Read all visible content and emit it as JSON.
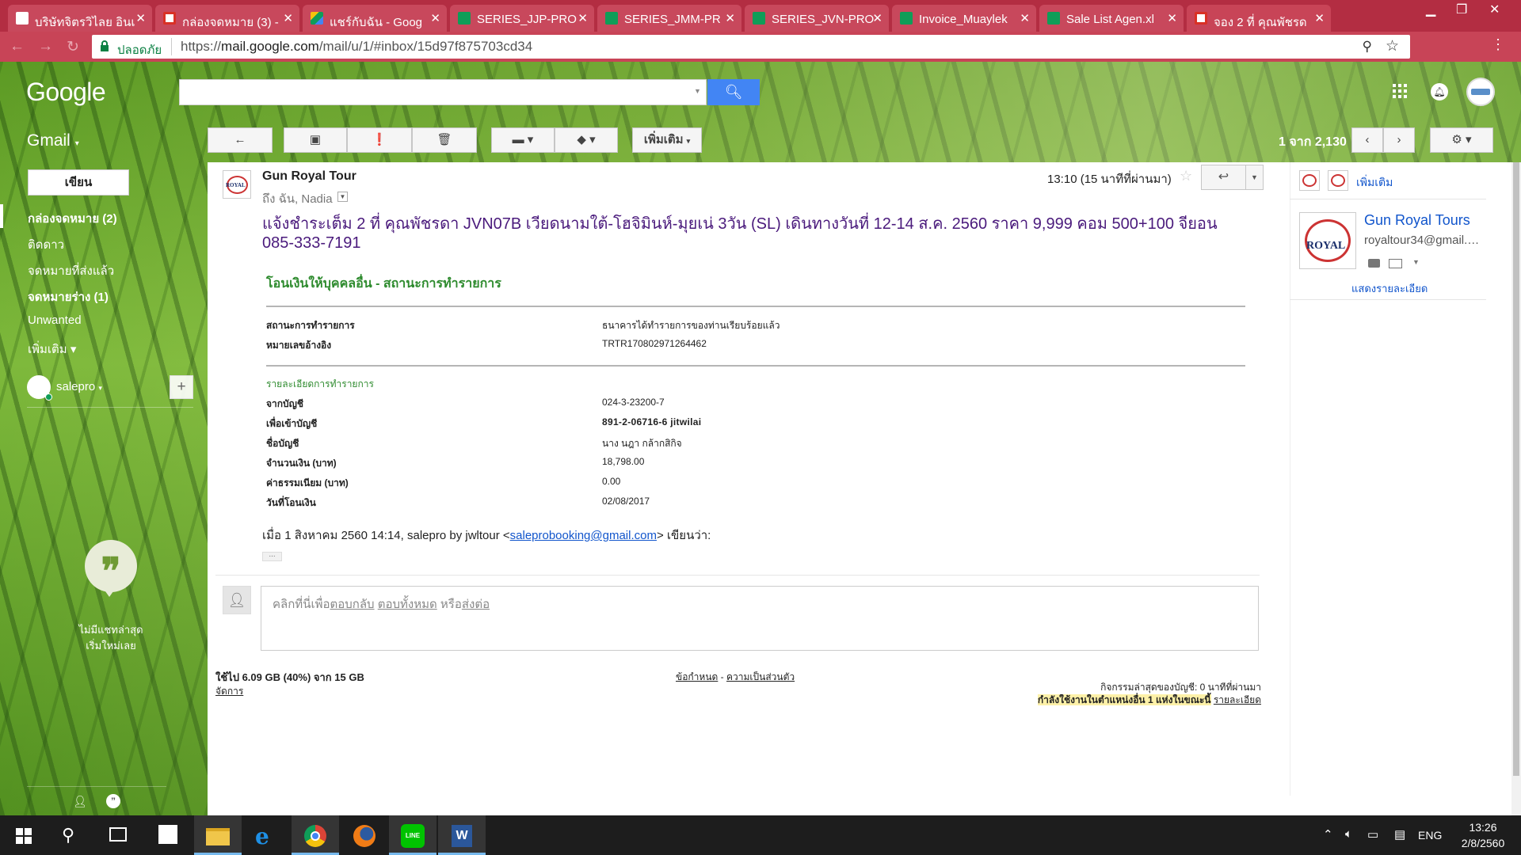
{
  "browser": {
    "tabs": [
      {
        "label": "บริษัทจิตรวิไลย อินเ",
        "active": false
      },
      {
        "label": "กล่องจดหมาย (3) -",
        "active": false
      },
      {
        "label": "แชร์กับฉัน - Goog",
        "active": false
      },
      {
        "label": "SERIES_JJP-PRO",
        "active": false
      },
      {
        "label": "SERIES_JMM-PR",
        "active": false
      },
      {
        "label": "SERIES_JVN-PRO",
        "active": false
      },
      {
        "label": "Invoice_Muaylek",
        "active": false
      },
      {
        "label": "Sale List Agen.xl",
        "active": false
      },
      {
        "label": "จอง 2 ที่ คุณพัชรด",
        "active": true
      }
    ],
    "secure_label": "ปลอดภัย",
    "url_prefix": "https://",
    "url_host": "mail.google.com",
    "url_path": "/mail/u/1/#inbox/15d97f875703cd34"
  },
  "gmail": {
    "logo": "Google",
    "app_label": "Gmail",
    "search_value": "",
    "more_button": "เพิ่มเติม",
    "page_info": "1 จาก 2,130",
    "compose": "เขียน",
    "nav": [
      {
        "label": "กล่องจดหมาย (2)",
        "bold": true
      },
      {
        "label": "ติดดาว",
        "bold": false
      },
      {
        "label": "จดหมายที่ส่งแล้ว",
        "bold": false
      },
      {
        "label": "จดหมายร่าง (1)",
        "bold": true
      },
      {
        "label": "Unwanted",
        "bold": false
      },
      {
        "label": "เพิ่มเติม ▾",
        "bold": false
      }
    ],
    "hangouts_user": "salepro",
    "no_chat_line1": "ไม่มีแชทล่าสุด",
    "no_chat_line2": "เริ่มใหม่เลย"
  },
  "email": {
    "sender": "Gun Royal Tour",
    "recipients": "ถึง ฉัน, Nadia",
    "timestamp": "13:10 (15 นาทีที่ผ่านมา)",
    "subject": "แจ้งชำระเต็ม 2 ที่ คุณพัชรดา JVN07B เวียดนามใต้-โฮจิมินห์-มุยเน่ 3วัน (SL) เดินทางวันที่ 12-14 ส.ค. 2560 ราคา 9,999 คอม 500+100 จียอน 085-333-7191",
    "bank_heading": "โอนเงินให้บุคคลอื่น - สถานะการทำรายการ",
    "status_label": "สถานะการทำรายการ",
    "status_value": "ธนาคารได้ทำรายการของท่านเรียบร้อยแล้ว",
    "ref_label": "หมายเลขอ้างอิง",
    "ref_value": "TRTR170802971264462",
    "detail_heading": "รายละเอียดการทำรายการ",
    "details": [
      {
        "label": "จากบัญชี",
        "value": "024-3-23200-7",
        "bold": false
      },
      {
        "label": "เพื่อเข้าบัญชี",
        "value": "891-2-06716-6 jitwilai",
        "bold": true
      },
      {
        "label": "ชื่อบัญชี",
        "value": "นาง นฎา กล้ากสิกิจ",
        "bold": false
      },
      {
        "label": "จำนวนเงิน (บาท)",
        "value": "18,798.00",
        "bold": false
      },
      {
        "label": "ค่าธรรมเนียม (บาท)",
        "value": "0.00",
        "bold": false
      },
      {
        "label": "วันที่โอนเงิน",
        "value": "02/08/2017",
        "bold": false
      }
    ],
    "quote_prefix": "เมื่อ 1 สิงหาคม 2560 14:14, salepro by jwltour <",
    "quote_email": "saleprobooking@gmail.com",
    "quote_suffix": "> เขียนว่า:",
    "ellipsis": "...",
    "reply_hint_prefix": "คลิกที่นี่เพื่อ",
    "reply_link": "ตอบกลับ",
    "reply_all_link": "ตอบทั้งหมด",
    "reply_or": " หรือ",
    "forward_link": "ส่งต่อ"
  },
  "footer": {
    "storage": "ใช้ไป 6.09 GB (40%) จาก 15 GB",
    "manage": "จัดการ",
    "terms": "ข้อกำหนด",
    "terms_sep": " - ",
    "privacy": "ความเป็นส่วนตัว",
    "activity": "กิจกรรมล่าสุดของบัญชี: 0 นาทีที่ผ่านมา",
    "other_location": "กำลังใช้งานในตำแหน่งอื่น 1 แห่งในขณะนี้",
    "details_link": "รายละเอียด"
  },
  "contact": {
    "more_label": "เพิ่มเติม",
    "name": "Gun Royal Tours",
    "email": "royaltour34@gmail.com",
    "show_details": "แสดงรายละเอียด",
    "logo_text": "ROYAL"
  },
  "taskbar": {
    "language": "ENG",
    "time": "13:26",
    "date": "2/8/2560"
  }
}
